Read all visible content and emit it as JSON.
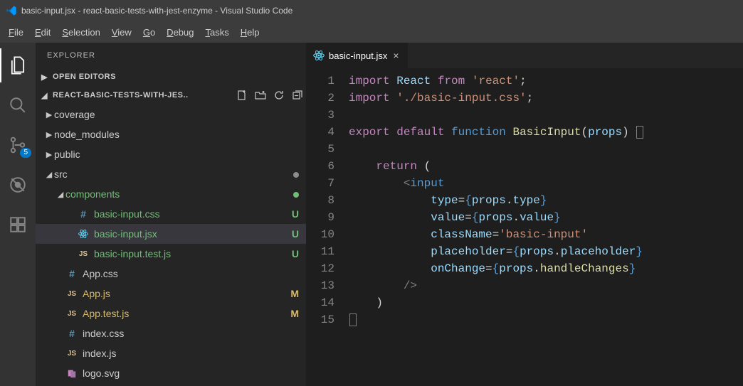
{
  "titlebar": {
    "title": "basic-input.jsx - react-basic-tests-with-jest-enzyme - Visual Studio Code"
  },
  "menubar": {
    "items": [
      {
        "label": "File",
        "underline_index": 0
      },
      {
        "label": "Edit",
        "underline_index": 0
      },
      {
        "label": "Selection",
        "underline_index": 0
      },
      {
        "label": "View",
        "underline_index": 0
      },
      {
        "label": "Go",
        "underline_index": 0
      },
      {
        "label": "Debug",
        "underline_index": 0
      },
      {
        "label": "Tasks",
        "underline_index": 0
      },
      {
        "label": "Help",
        "underline_index": 0
      }
    ]
  },
  "activitybar": {
    "scm_badge": "5"
  },
  "sidebar": {
    "title": "EXPLORER",
    "sections": {
      "open_editors": "OPEN EDITORS",
      "project": "REACT-BASIC-TESTS-WITH-JES.."
    },
    "tree": [
      {
        "type": "folder",
        "expanded": false,
        "depth": 0,
        "label": "coverage"
      },
      {
        "type": "folder",
        "expanded": false,
        "depth": 0,
        "label": "node_modules"
      },
      {
        "type": "folder",
        "expanded": false,
        "depth": 0,
        "label": "public"
      },
      {
        "type": "folder",
        "expanded": true,
        "depth": 0,
        "label": "src",
        "dot": "grey"
      },
      {
        "type": "folder",
        "expanded": true,
        "depth": 1,
        "label": "components",
        "dot": "green",
        "git": "u"
      },
      {
        "type": "file",
        "depth": 2,
        "icon": "hash",
        "label": "basic-input.css",
        "status": "U",
        "git": "u"
      },
      {
        "type": "file",
        "depth": 2,
        "icon": "react",
        "label": "basic-input.jsx",
        "status": "U",
        "git": "u",
        "selected": true
      },
      {
        "type": "file",
        "depth": 2,
        "icon": "js",
        "label": "basic-input.test.js",
        "status": "U",
        "git": "u"
      },
      {
        "type": "file",
        "depth": 1,
        "icon": "hash",
        "label": "App.css"
      },
      {
        "type": "file",
        "depth": 1,
        "icon": "js",
        "label": "App.js",
        "status": "M",
        "git": "m"
      },
      {
        "type": "file",
        "depth": 1,
        "icon": "js",
        "label": "App.test.js",
        "status": "M",
        "git": "m"
      },
      {
        "type": "file",
        "depth": 1,
        "icon": "hash",
        "label": "index.css"
      },
      {
        "type": "file",
        "depth": 1,
        "icon": "js",
        "label": "index.js"
      },
      {
        "type": "file",
        "depth": 1,
        "icon": "purple",
        "label": "logo.svg"
      }
    ]
  },
  "editor": {
    "tab": {
      "label": "basic-input.jsx",
      "icon": "react"
    },
    "lines": [
      {
        "n": 1,
        "tokens": [
          {
            "t": "kw",
            "v": "import"
          },
          {
            "t": "sp",
            "v": " "
          },
          {
            "t": "var",
            "v": "React"
          },
          {
            "t": "sp",
            "v": " "
          },
          {
            "t": "kw",
            "v": "from"
          },
          {
            "t": "sp",
            "v": " "
          },
          {
            "t": "str",
            "v": "'react'"
          },
          {
            "t": "punc",
            "v": ";"
          }
        ]
      },
      {
        "n": 2,
        "tokens": [
          {
            "t": "kw",
            "v": "import"
          },
          {
            "t": "sp",
            "v": " "
          },
          {
            "t": "str",
            "v": "'./basic-input.css'"
          },
          {
            "t": "punc",
            "v": ";"
          }
        ]
      },
      {
        "n": 3,
        "tokens": []
      },
      {
        "n": 4,
        "tokens": [
          {
            "t": "kw",
            "v": "export"
          },
          {
            "t": "sp",
            "v": " "
          },
          {
            "t": "kw",
            "v": "default"
          },
          {
            "t": "sp",
            "v": " "
          },
          {
            "t": "kw2",
            "v": "function"
          },
          {
            "t": "sp",
            "v": " "
          },
          {
            "t": "fn",
            "v": "BasicInput"
          },
          {
            "t": "punc",
            "v": "("
          },
          {
            "t": "var",
            "v": "props"
          },
          {
            "t": "punc",
            "v": ") "
          },
          {
            "t": "box",
            "v": "{"
          }
        ]
      },
      {
        "n": 5,
        "tokens": []
      },
      {
        "n": 6,
        "tokens": [
          {
            "t": "indent",
            "v": "    "
          },
          {
            "t": "kw",
            "v": "return"
          },
          {
            "t": "sp",
            "v": " "
          },
          {
            "t": "punc",
            "v": "("
          }
        ]
      },
      {
        "n": 7,
        "tokens": [
          {
            "t": "indent",
            "v": "        "
          },
          {
            "t": "angle",
            "v": "<"
          },
          {
            "t": "tag",
            "v": "input"
          }
        ]
      },
      {
        "n": 8,
        "tokens": [
          {
            "t": "indent",
            "v": "            "
          },
          {
            "t": "var",
            "v": "type"
          },
          {
            "t": "punc",
            "v": "="
          },
          {
            "t": "kw2",
            "v": "{"
          },
          {
            "t": "var",
            "v": "props"
          },
          {
            "t": "punc",
            "v": "."
          },
          {
            "t": "var",
            "v": "type"
          },
          {
            "t": "kw2",
            "v": "}"
          }
        ]
      },
      {
        "n": 9,
        "tokens": [
          {
            "t": "indent",
            "v": "            "
          },
          {
            "t": "var",
            "v": "value"
          },
          {
            "t": "punc",
            "v": "="
          },
          {
            "t": "kw2",
            "v": "{"
          },
          {
            "t": "var",
            "v": "props"
          },
          {
            "t": "punc",
            "v": "."
          },
          {
            "t": "var",
            "v": "value"
          },
          {
            "t": "kw2",
            "v": "}"
          }
        ]
      },
      {
        "n": 10,
        "tokens": [
          {
            "t": "indent",
            "v": "            "
          },
          {
            "t": "var",
            "v": "className"
          },
          {
            "t": "punc",
            "v": "="
          },
          {
            "t": "str",
            "v": "'basic-input'"
          }
        ]
      },
      {
        "n": 11,
        "tokens": [
          {
            "t": "indent",
            "v": "            "
          },
          {
            "t": "var",
            "v": "placeholder"
          },
          {
            "t": "punc",
            "v": "="
          },
          {
            "t": "kw2",
            "v": "{"
          },
          {
            "t": "var",
            "v": "props"
          },
          {
            "t": "punc",
            "v": "."
          },
          {
            "t": "var",
            "v": "placeholder"
          },
          {
            "t": "kw2",
            "v": "}"
          }
        ]
      },
      {
        "n": 12,
        "tokens": [
          {
            "t": "indent",
            "v": "            "
          },
          {
            "t": "var",
            "v": "onChange"
          },
          {
            "t": "punc",
            "v": "="
          },
          {
            "t": "kw2",
            "v": "{"
          },
          {
            "t": "var",
            "v": "props"
          },
          {
            "t": "punc",
            "v": "."
          },
          {
            "t": "fn",
            "v": "handleChanges"
          },
          {
            "t": "kw2",
            "v": "}"
          }
        ]
      },
      {
        "n": 13,
        "tokens": [
          {
            "t": "indent",
            "v": "        "
          },
          {
            "t": "angle",
            "v": "/>"
          }
        ]
      },
      {
        "n": 14,
        "tokens": [
          {
            "t": "indent",
            "v": "    "
          },
          {
            "t": "punc",
            "v": ")"
          }
        ]
      },
      {
        "n": 15,
        "tokens": [
          {
            "t": "box",
            "v": "}"
          }
        ]
      }
    ]
  }
}
